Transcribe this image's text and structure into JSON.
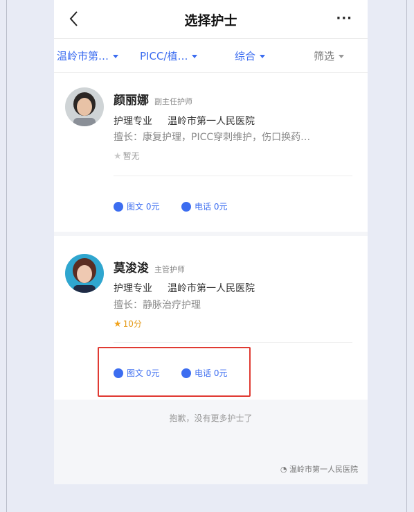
{
  "nav": {
    "title": "选择护士",
    "more_label": "···"
  },
  "filters": [
    {
      "label": "温岭市第…"
    },
    {
      "label": "PICC/植…"
    },
    {
      "label": "综合"
    },
    {
      "label": "筛选"
    }
  ],
  "nurses": [
    {
      "name": "颜丽娜",
      "title": "副主任护师",
      "major": "护理专业",
      "hospital": "温岭市第一人民医院",
      "specialty": "擅长：康复护理，PICC穿刺维护，伤口换药…",
      "rating": "暂无",
      "services": [
        {
          "label": "图文 0元"
        },
        {
          "label": "电话 0元"
        }
      ]
    },
    {
      "name": "莫浚浚",
      "title": "主管护师",
      "major": "护理专业",
      "hospital": "温岭市第一人民医院",
      "specialty": "擅长：静脉治疗护理",
      "rating": "10分",
      "services": [
        {
          "label": "图文 0元"
        },
        {
          "label": "电话 0元"
        }
      ]
    }
  ],
  "footer": {
    "no_more": "抱歉，没有更多护士了",
    "watermark": "温岭市第一人民医院"
  },
  "colors": {
    "accent": "#3c6df0",
    "star": "#f1a21a",
    "highlight": "#e03a32"
  },
  "icons": [
    "back-arrow-icon",
    "more-icon",
    "chevron-down-icon",
    "star-icon",
    "image-text-icon",
    "phone-icon",
    "wechat-icon"
  ]
}
